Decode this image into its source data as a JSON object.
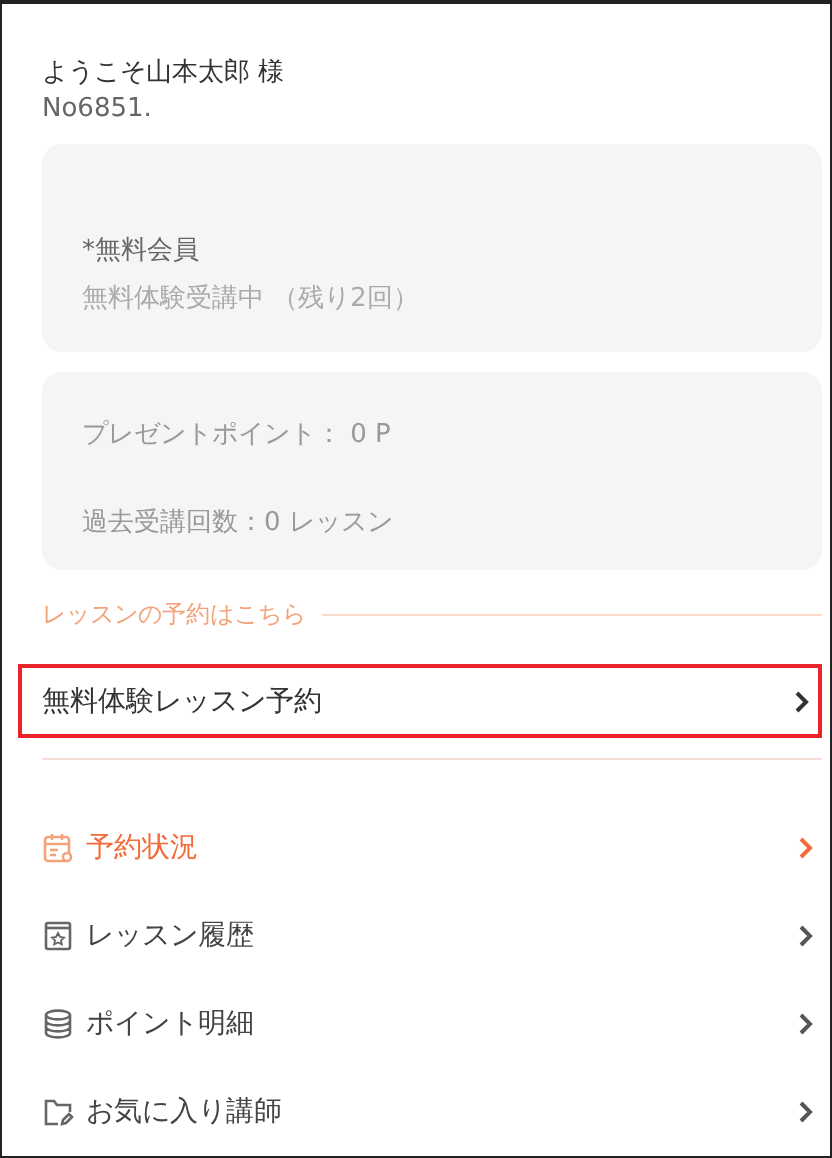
{
  "greeting": {
    "welcome": "ようこそ山本太郎 様",
    "member_no": "No6851."
  },
  "membership_card": {
    "type": "*無料会員",
    "status": "無料体験受講中 （残り2回）"
  },
  "points_card": {
    "points": "プレゼントポイント： 0 P",
    "lessons": "過去受講回数：0  レッスン"
  },
  "booking_section": {
    "heading": "レッスンの予約はこちら",
    "item": {
      "label": "無料体験レッスン予約",
      "highlighted": true
    }
  },
  "menu": [
    {
      "kind": "calendar",
      "label": "予約状況",
      "selected": true
    },
    {
      "kind": "history",
      "label": "レッスン履歴",
      "selected": false
    },
    {
      "kind": "points",
      "label": "ポイント明細",
      "selected": false
    },
    {
      "kind": "favorites",
      "label": "お気に入り講師",
      "selected": false
    }
  ]
}
